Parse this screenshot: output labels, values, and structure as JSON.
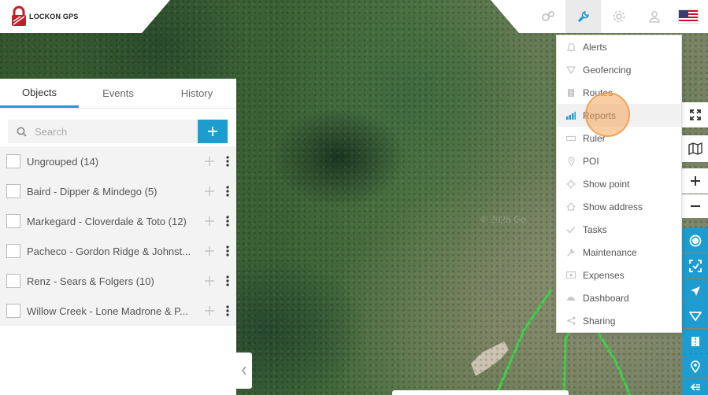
{
  "brand": {
    "name": "LOCKON GPS"
  },
  "map": {
    "copyright": "© 2025 Go"
  },
  "topbar": {
    "icons": [
      {
        "name": "objects-settings-icon",
        "active": false
      },
      {
        "name": "tools-icon",
        "active": true
      },
      {
        "name": "settings-icon",
        "active": false
      },
      {
        "name": "user-icon",
        "active": false
      },
      {
        "name": "us-flag-icon",
        "active": false
      }
    ]
  },
  "tools_menu": {
    "items": [
      {
        "label": "Alerts",
        "icon": "bell-icon",
        "active": false
      },
      {
        "label": "Geofencing",
        "icon": "geofence-icon",
        "active": false
      },
      {
        "label": "Routes",
        "icon": "road-icon",
        "active": false
      },
      {
        "label": "Reports",
        "icon": "bar-chart-icon",
        "active": true
      },
      {
        "label": "Ruler",
        "icon": "ruler-icon",
        "active": false
      },
      {
        "label": "POI",
        "icon": "map-marker-icon",
        "active": false
      },
      {
        "label": "Show point",
        "icon": "crosshair-icon",
        "active": false
      },
      {
        "label": "Show address",
        "icon": "home-icon",
        "active": false
      },
      {
        "label": "Tasks",
        "icon": "check-icon",
        "active": false
      },
      {
        "label": "Maintenance",
        "icon": "wrench-icon",
        "active": false
      },
      {
        "label": "Expenses",
        "icon": "money-icon",
        "active": false
      },
      {
        "label": "Dashboard",
        "icon": "gauge-icon",
        "active": false
      },
      {
        "label": "Sharing",
        "icon": "share-icon",
        "active": false
      }
    ]
  },
  "panel": {
    "tabs": [
      {
        "label": "Objects",
        "active": true
      },
      {
        "label": "Events",
        "active": false
      },
      {
        "label": "History",
        "active": false
      }
    ],
    "search": {
      "placeholder": "Search",
      "value": ""
    },
    "groups": [
      {
        "label": "Ungrouped (14)"
      },
      {
        "label": "Baird - Dipper & Mindego (5)"
      },
      {
        "label": "Markegard - Cloverdale & Toto (12)"
      },
      {
        "label": "Pacheco - Gordon Ridge & Johnst..."
      },
      {
        "label": "Renz - Sears & Folgers (10)"
      },
      {
        "label": "Willow Creek - Lone Madrone & P..."
      }
    ]
  },
  "right_toolbar": [
    {
      "name": "fullscreen-icon",
      "style": "white"
    },
    {
      "name": "map-layers-icon",
      "style": "white"
    },
    {
      "name": "zoom-in-icon",
      "style": "white"
    },
    {
      "name": "zoom-out-icon",
      "style": "white"
    },
    {
      "name": "objects-toggle-icon",
      "style": "blue"
    },
    {
      "name": "fit-bounds-icon",
      "style": "blue"
    },
    {
      "name": "my-location-icon",
      "style": "blue"
    },
    {
      "name": "geofence-toggle-icon",
      "style": "blue"
    },
    {
      "name": "routes-toggle-icon",
      "style": "blue"
    },
    {
      "name": "poi-toggle-icon",
      "style": "blue"
    },
    {
      "name": "more-toggle-icon",
      "style": "blue"
    }
  ],
  "colors": {
    "accent": "#1e9ccf",
    "route": "#3fd14a",
    "click_marker": "#f5a65a"
  }
}
